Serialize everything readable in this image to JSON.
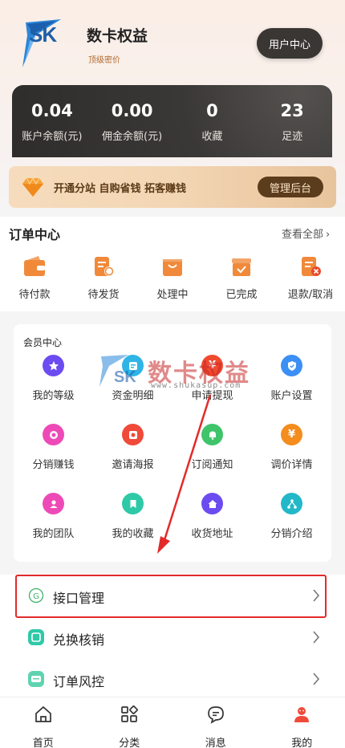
{
  "header": {
    "logo_text": "SK",
    "title": "数卡权益",
    "subtitle": "顶级密价",
    "user_center_label": "用户中心"
  },
  "stats": [
    {
      "value": "0.04",
      "label": "账户余额(元)"
    },
    {
      "value": "0.00",
      "label": "佣金余额(元)"
    },
    {
      "value": "0",
      "label": "收藏"
    },
    {
      "value": "23",
      "label": "足迹"
    }
  ],
  "promo": {
    "text": "开通分站 自购省钱 拓客赚钱",
    "button_label": "管理后台"
  },
  "orders": {
    "title": "订单中心",
    "view_all_label": "查看全部",
    "items": [
      {
        "label": "待付款",
        "icon": "wallet-icon"
      },
      {
        "label": "待发货",
        "icon": "pending-shipment-icon"
      },
      {
        "label": "处理中",
        "icon": "shopping-bag-icon"
      },
      {
        "label": "已完成",
        "icon": "completed-box-icon"
      },
      {
        "label": "退款/取消",
        "icon": "refund-icon"
      }
    ]
  },
  "member": {
    "title": "会员中心",
    "items": [
      {
        "label": "我的等级",
        "icon": "star-icon",
        "color": "#6c4cf0"
      },
      {
        "label": "资金明细",
        "icon": "funds-icon",
        "color": "#2fb4e6"
      },
      {
        "label": "申请提现",
        "icon": "yen-icon",
        "color": "#f04a2f"
      },
      {
        "label": "账户设置",
        "icon": "shield-icon",
        "color": "#3b8ff5"
      },
      {
        "label": "分销赚钱",
        "icon": "coins-icon",
        "color": "#ee4ab7"
      },
      {
        "label": "邀请海报",
        "icon": "poster-icon",
        "color": "#f04a3a"
      },
      {
        "label": "订阅通知",
        "icon": "bell-icon",
        "color": "#3fc46a"
      },
      {
        "label": "调价详情",
        "icon": "yen-price-icon",
        "color": "#f58c1e"
      },
      {
        "label": "我的团队",
        "icon": "team-icon",
        "color": "#ee4ab7"
      },
      {
        "label": "我的收藏",
        "icon": "bookmark-icon",
        "color": "#2fc9a7"
      },
      {
        "label": "收货地址",
        "icon": "home-icon",
        "color": "#6c4cf0"
      },
      {
        "label": "分销介绍",
        "icon": "network-icon",
        "color": "#22b8c8"
      }
    ]
  },
  "watermark": {
    "text": "数卡权益",
    "url": "www.shukasup.com"
  },
  "list": [
    {
      "label": "接口管理",
      "icon": "api-g-icon"
    },
    {
      "label": "兑换核销",
      "icon": "redeem-icon"
    },
    {
      "label": "订单风控",
      "icon": "risk-control-icon"
    }
  ],
  "nav": [
    {
      "label": "首页",
      "icon": "home-nav-icon"
    },
    {
      "label": "分类",
      "icon": "category-icon"
    },
    {
      "label": "消息",
      "icon": "message-icon"
    },
    {
      "label": "我的",
      "icon": "profile-icon"
    }
  ],
  "colors": {
    "accent_dark": "#3a3634",
    "gold": "#5b3c1c",
    "highlight_red": "#e32a2a",
    "nav_active": "#f04a3a"
  }
}
